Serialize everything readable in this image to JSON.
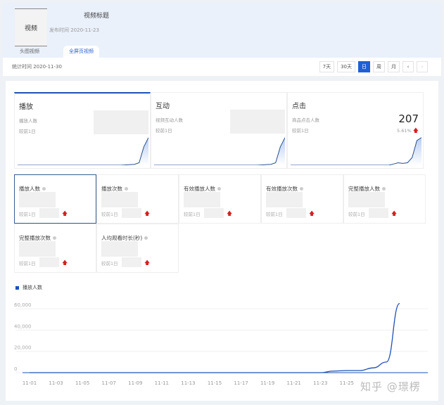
{
  "header": {
    "thumb_label": "视频",
    "title": "视频标题",
    "publish": "发布时间 2020-11-23",
    "tabs": [
      {
        "label": "头图视频",
        "active": false
      },
      {
        "label": "全屏页视频",
        "active": true
      }
    ]
  },
  "statbar": {
    "stat_time": "统计时间 2020-11-30",
    "buttons": [
      {
        "label": "7天"
      },
      {
        "label": "30天"
      },
      {
        "label": "日",
        "selected": true
      },
      {
        "label": "周"
      },
      {
        "label": "月"
      },
      {
        "label": "‹"
      },
      {
        "label": "›",
        "disabled": true
      }
    ]
  },
  "overview_cards": [
    {
      "title": "播放",
      "sub": "播放人数",
      "compare": "较前1日",
      "active": true
    },
    {
      "title": "互动",
      "sub": "视频互动人数",
      "compare": "较前1日"
    },
    {
      "title": "点击",
      "sub": "商品点击人数",
      "compare": "较前1日",
      "value": "207",
      "change": "5.61%",
      "trend": "up"
    }
  ],
  "metrics": [
    {
      "label": "播放人数",
      "compare": "较前1日",
      "selected": true
    },
    {
      "label": "播放次数",
      "compare": "较前1日"
    },
    {
      "label": "有效播放人数",
      "compare": "较前1日"
    },
    {
      "label": "有效播放次数",
      "compare": "较前1日"
    },
    {
      "label": "完整播放人数",
      "compare": "较前1日"
    },
    {
      "label": "完整播放次数",
      "compare": "较前1日"
    },
    {
      "label": "人均观看时长(秒)",
      "compare": "较前1日"
    }
  ],
  "icons": {
    "trend": "arrow-up-icon",
    "info": "info-dot-icon"
  },
  "colors": {
    "accent": "#1f5fd6",
    "line": "#1e50b8",
    "up": "#d42020"
  },
  "chart_data": {
    "type": "line",
    "legend": [
      "播放人数"
    ],
    "legend_placement": "top-left",
    "x": [
      "11-01",
      "11-02",
      "11-03",
      "11-04",
      "11-05",
      "11-06",
      "11-07",
      "11-08",
      "11-09",
      "11-10",
      "11-11",
      "11-12",
      "11-13",
      "11-14",
      "11-15",
      "11-16",
      "11-17",
      "11-18",
      "11-19",
      "11-20",
      "11-21",
      "11-22",
      "11-23",
      "11-24",
      "11-25",
      "11-26",
      "11-27",
      "11-28",
      "11-29"
    ],
    "x_ticks": [
      "11-01",
      "11-03",
      "11-05",
      "11-07",
      "11-09",
      "11-11",
      "11-13",
      "11-15",
      "11-17",
      "11-19",
      "11-21",
      "11-23",
      "11-25"
    ],
    "series": [
      {
        "name": "播放人数",
        "values": [
          0,
          0,
          0,
          0,
          0,
          0,
          0,
          0,
          0,
          0,
          0,
          0,
          0,
          0,
          0,
          0,
          0,
          0,
          0,
          0,
          0,
          0,
          0,
          1500,
          2000,
          2000,
          4500,
          10000,
          65000
        ]
      }
    ],
    "y_ticks": [
      "0",
      "20,000",
      "40,000",
      "60,000"
    ],
    "ylim": [
      0,
      66000
    ],
    "grid": true
  },
  "watermark": "知乎 @璟楞"
}
